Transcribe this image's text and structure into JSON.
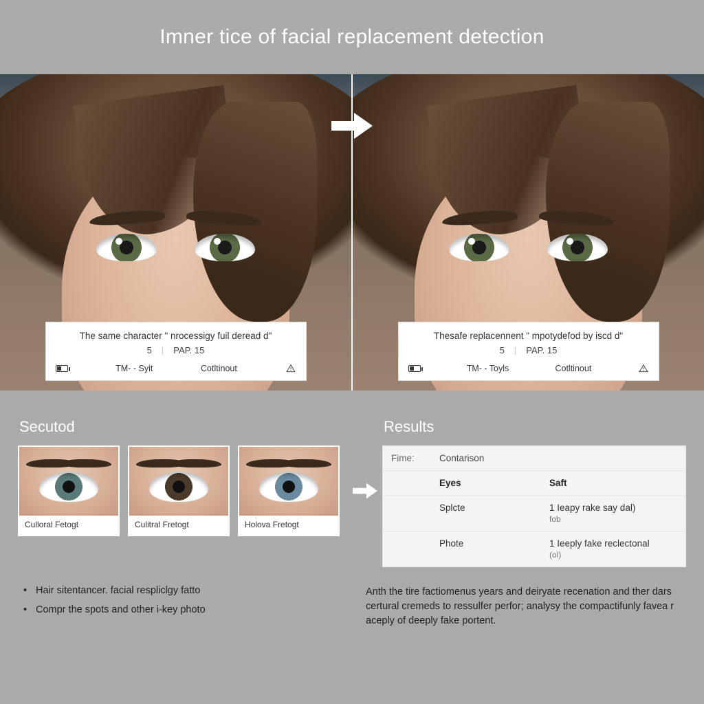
{
  "header": {
    "title": "Imner tice of facial replacement detection"
  },
  "comparison": {
    "left": {
      "caption": "The same character \" nrocessigy fuil deread d\"",
      "meta_a": "5",
      "meta_b": "PAP. 15",
      "tool_a": "TM- - Syit",
      "tool_b": "Cotltinout"
    },
    "right": {
      "caption": "Thesafe replacennent \" mpotydefod by iscd d\"",
      "meta_a": "5",
      "meta_b": "PAP. 15",
      "tool_a": "TM- - Toyls",
      "tool_b": "Cotltinout"
    }
  },
  "secutod": {
    "title": "Secutod",
    "thumbs": [
      {
        "label": "Culloral Fetogt",
        "iris": "#5a7a7a"
      },
      {
        "label": "Culitral Fretogt",
        "iris": "#4a3a2a"
      },
      {
        "label": "Holova Fretogt",
        "iris": "#6a8aa0"
      }
    ]
  },
  "results": {
    "title": "Results",
    "header_left": "Fime:",
    "header_right": "Contarison",
    "rows": [
      {
        "k": "Eyes",
        "v": "Saft"
      },
      {
        "k": "Splcte",
        "v": "1 Ieapy rake say dal)",
        "sub": "fob"
      },
      {
        "k": "Phote",
        "v": "1 Ieeply fake reclectonal",
        "sub": "(ol)"
      }
    ]
  },
  "footer": {
    "bullets": [
      "Hair sitentancer. facial respliclgy fatto",
      "Compr the spots and other i-key photo"
    ],
    "para": "Anth the tire factiomenus years and deiryate recenation and ther dars certural cremeds to ressulfer perfor; analysy the compactifunly favea r aceply of deeply fake portent."
  }
}
